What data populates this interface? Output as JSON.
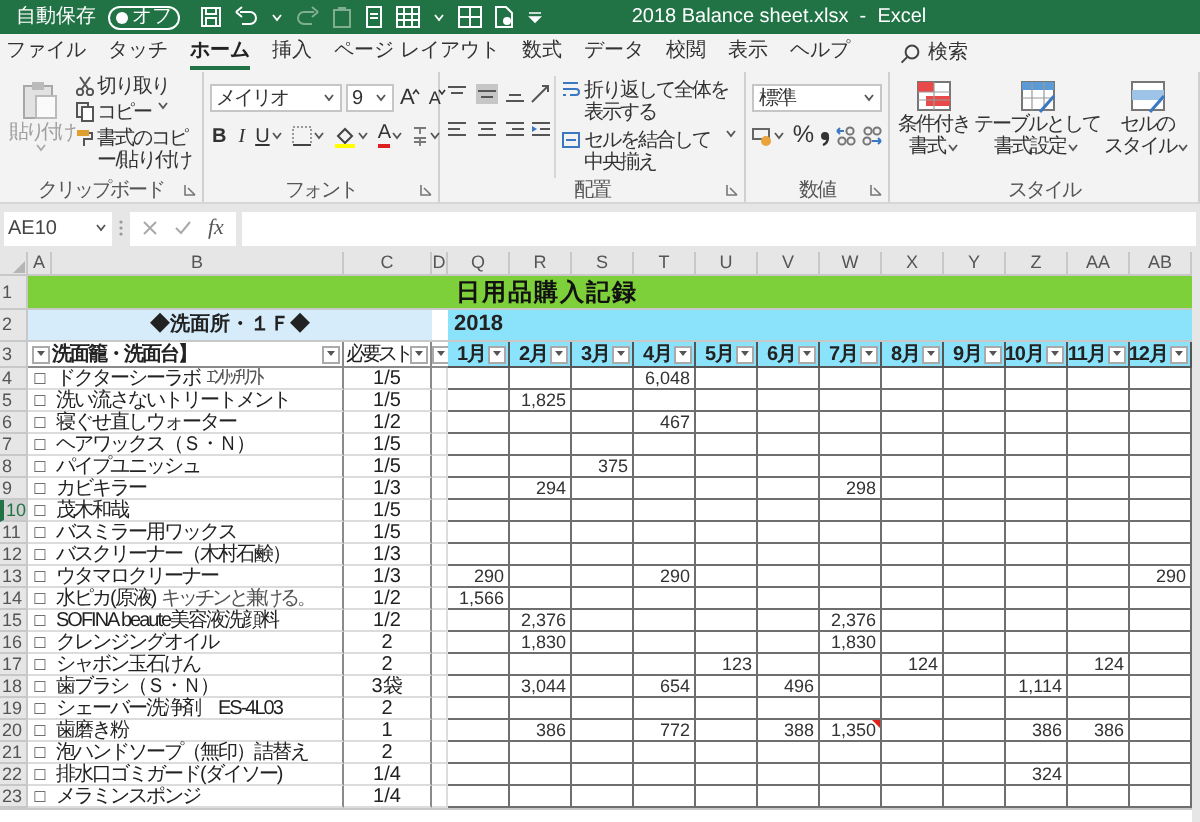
{
  "title_bar": {
    "autosave_label": "自動保存",
    "autosave_state": "オフ",
    "autosave_on": false,
    "title": "2018 Balance sheet.xlsx  -  Excel"
  },
  "menu_tabs": [
    {
      "label": "ファイル",
      "selected": false
    },
    {
      "label": "タッチ",
      "selected": false
    },
    {
      "label": "ホーム",
      "selected": true
    },
    {
      "label": "挿入",
      "selected": false
    },
    {
      "label": "ページ レイアウト",
      "selected": false
    },
    {
      "label": "数式",
      "selected": false
    },
    {
      "label": "データ",
      "selected": false
    },
    {
      "label": "校閲",
      "selected": false
    },
    {
      "label": "表示",
      "selected": false
    },
    {
      "label": "ヘルプ",
      "selected": false
    }
  ],
  "search": {
    "label": "検索"
  },
  "ribbon": {
    "clipboard": {
      "paste": "貼り付け",
      "paste_disabled": true,
      "cut": "切り取り",
      "copy": "コピー",
      "format_painter": "書式のコピー/貼り付け",
      "label": "クリップボード"
    },
    "font": {
      "font_name": "メイリオ",
      "font_size": "9",
      "grow": "A",
      "shrink": "A",
      "bold": "B",
      "italic": "I",
      "underline": "U",
      "font_color": "A",
      "label": "フォント"
    },
    "alignment": {
      "wrap_text": "折り返して全体を表示する",
      "merge_center": "セルを結合して中央揃え",
      "label": "配置"
    },
    "number": {
      "format": "標準",
      "percent": "%",
      "label": "数値"
    },
    "styles": {
      "buttons": [
        {
          "lines": [
            "条件付き",
            "書式"
          ]
        },
        {
          "lines": [
            "テーブルとして",
            "書式設定"
          ]
        },
        {
          "lines": [
            "セルの",
            "スタイル"
          ]
        }
      ],
      "label": "スタイル"
    }
  },
  "formula_bar": {
    "name_box": "AE10",
    "function_label": "fx"
  },
  "sheet": {
    "column_headers": [
      "A",
      "B",
      "C",
      "D",
      "Q",
      "R",
      "S",
      "T",
      "U",
      "V",
      "W",
      "X",
      "Y",
      "Z",
      "AA",
      "AB"
    ],
    "title_row": {
      "number": "1",
      "title": "日用品購入記録"
    },
    "section_row": {
      "number": "2",
      "section": "◆洗面所・１Ｆ◆",
      "year": "2018"
    },
    "header_row": {
      "number": "3",
      "item_header": "洗面籠・洗面台】",
      "quota_header": "必要スト",
      "months": [
        "1月",
        "2月",
        "3月",
        "4月",
        "5月",
        "6月",
        "7月",
        "8月",
        "9月",
        "10月",
        "11月",
        "12月"
      ]
    },
    "rows": [
      {
        "number": "4",
        "selected": false,
        "mark": "□",
        "name": "ドクターシーラボ",
        "note": "ｴﾝﾘｯﾁﾘﾌﾄ",
        "quota": "1/5",
        "months": [
          {
            "comment": false
          },
          {
            "comment": false
          },
          {
            "comment": false
          },
          {
            "value": "6,048",
            "comment": false
          },
          {
            "comment": false
          },
          {
            "comment": false
          },
          {
            "comment": false
          },
          {
            "comment": false
          },
          {
            "comment": false
          },
          {
            "comment": false
          },
          {
            "comment": false
          },
          {
            "comment": false
          }
        ]
      },
      {
        "number": "5",
        "selected": false,
        "mark": "□",
        "name": "洗い流さないトリートメント",
        "quota": "1/5",
        "months": [
          {
            "comment": false
          },
          {
            "value": "1,825",
            "comment": false
          },
          {
            "comment": false
          },
          {
            "comment": false
          },
          {
            "comment": false
          },
          {
            "comment": false
          },
          {
            "comment": false
          },
          {
            "comment": false
          },
          {
            "comment": false
          },
          {
            "comment": false
          },
          {
            "comment": false
          },
          {
            "comment": false
          }
        ]
      },
      {
        "number": "6",
        "selected": false,
        "mark": "□",
        "name": "寝ぐせ直しウォーター",
        "quota": "1/2",
        "months": [
          {
            "comment": false
          },
          {
            "comment": false
          },
          {
            "comment": false
          },
          {
            "value": "467",
            "comment": false
          },
          {
            "comment": false
          },
          {
            "comment": false
          },
          {
            "comment": false
          },
          {
            "comment": false
          },
          {
            "comment": false
          },
          {
            "comment": false
          },
          {
            "comment": false
          },
          {
            "comment": false
          }
        ]
      },
      {
        "number": "7",
        "selected": false,
        "mark": "□",
        "name": "ヘアワックス（Ｓ・Ｎ）",
        "quota": "1/5",
        "months": [
          {
            "comment": false
          },
          {
            "comment": false
          },
          {
            "comment": false
          },
          {
            "comment": false
          },
          {
            "comment": false
          },
          {
            "comment": false
          },
          {
            "comment": false
          },
          {
            "comment": false
          },
          {
            "comment": false
          },
          {
            "comment": false
          },
          {
            "comment": false
          },
          {
            "comment": false
          }
        ]
      },
      {
        "number": "8",
        "selected": false,
        "mark": "□",
        "name": "パイプユニッシュ",
        "quota": "1/5",
        "months": [
          {
            "comment": false
          },
          {
            "comment": false
          },
          {
            "value": "375",
            "comment": false
          },
          {
            "comment": false
          },
          {
            "comment": false
          },
          {
            "comment": false
          },
          {
            "comment": false
          },
          {
            "comment": false
          },
          {
            "comment": false
          },
          {
            "comment": false
          },
          {
            "comment": false
          },
          {
            "comment": false
          }
        ]
      },
      {
        "number": "9",
        "selected": false,
        "mark": "□",
        "name": "カビキラー",
        "quota": "1/3",
        "months": [
          {
            "comment": false
          },
          {
            "value": "294",
            "comment": false
          },
          {
            "comment": false
          },
          {
            "comment": false
          },
          {
            "comment": false
          },
          {
            "comment": false
          },
          {
            "value": "298",
            "comment": false
          },
          {
            "comment": false
          },
          {
            "comment": false
          },
          {
            "comment": false
          },
          {
            "comment": false
          },
          {
            "comment": false
          }
        ]
      },
      {
        "number": "10",
        "selected": true,
        "mark": "□",
        "name": "茂木和哉",
        "quota": "1/5",
        "months": [
          {
            "comment": false
          },
          {
            "comment": false
          },
          {
            "comment": false
          },
          {
            "comment": false
          },
          {
            "comment": false
          },
          {
            "comment": false
          },
          {
            "comment": false
          },
          {
            "comment": false
          },
          {
            "comment": false
          },
          {
            "comment": false
          },
          {
            "comment": false
          },
          {
            "comment": false
          }
        ]
      },
      {
        "number": "11",
        "selected": false,
        "mark": "□",
        "name": "バスミラー用ワックス",
        "quota": "1/5",
        "months": [
          {
            "comment": false
          },
          {
            "comment": false
          },
          {
            "comment": false
          },
          {
            "comment": false
          },
          {
            "comment": false
          },
          {
            "comment": false
          },
          {
            "comment": false
          },
          {
            "comment": false
          },
          {
            "comment": false
          },
          {
            "comment": false
          },
          {
            "comment": false
          },
          {
            "comment": false
          }
        ]
      },
      {
        "number": "12",
        "selected": false,
        "mark": "□",
        "name": "バスクリーナー（木村石鹸）",
        "quota": "1/3",
        "months": [
          {
            "comment": false
          },
          {
            "comment": false
          },
          {
            "comment": false
          },
          {
            "comment": false
          },
          {
            "comment": false
          },
          {
            "comment": false
          },
          {
            "comment": false
          },
          {
            "comment": false
          },
          {
            "comment": false
          },
          {
            "comment": false
          },
          {
            "comment": false
          },
          {
            "comment": false
          }
        ]
      },
      {
        "number": "13",
        "selected": false,
        "mark": "□",
        "name": "ウタマロクリーナー",
        "quota": "1/3",
        "months": [
          {
            "value": "290",
            "comment": false
          },
          {
            "comment": false
          },
          {
            "comment": false
          },
          {
            "value": "290",
            "comment": false
          },
          {
            "comment": false
          },
          {
            "comment": false
          },
          {
            "comment": false
          },
          {
            "comment": false
          },
          {
            "comment": false
          },
          {
            "comment": false
          },
          {
            "comment": false
          },
          {
            "value": "290",
            "comment": false
          }
        ]
      },
      {
        "number": "14",
        "selected": false,
        "mark": "□",
        "name": "水ピカ(原液)",
        "note": "キッチンと兼ける。",
        "quota": "1/2",
        "months": [
          {
            "value": "1,566",
            "comment": false
          },
          {
            "comment": false
          },
          {
            "comment": false
          },
          {
            "comment": false
          },
          {
            "comment": false
          },
          {
            "comment": false
          },
          {
            "comment": false
          },
          {
            "comment": false
          },
          {
            "comment": false
          },
          {
            "comment": false
          },
          {
            "comment": false
          },
          {
            "comment": false
          }
        ]
      },
      {
        "number": "15",
        "selected": false,
        "mark": "□",
        "name": "SOFINA beaute美容液洗顔料",
        "quota": "1/2",
        "months": [
          {
            "comment": false
          },
          {
            "value": "2,376",
            "comment": false
          },
          {
            "comment": false
          },
          {
            "comment": false
          },
          {
            "comment": false
          },
          {
            "comment": false
          },
          {
            "value": "2,376",
            "comment": false
          },
          {
            "comment": false
          },
          {
            "comment": false
          },
          {
            "comment": false
          },
          {
            "comment": false
          },
          {
            "comment": false
          }
        ]
      },
      {
        "number": "16",
        "selected": false,
        "mark": "□",
        "name": "クレンジングオイル",
        "quota": "2",
        "months": [
          {
            "comment": false
          },
          {
            "value": "1,830",
            "comment": false
          },
          {
            "comment": false
          },
          {
            "comment": false
          },
          {
            "comment": false
          },
          {
            "comment": false
          },
          {
            "value": "1,830",
            "comment": false
          },
          {
            "comment": false
          },
          {
            "comment": false
          },
          {
            "comment": false
          },
          {
            "comment": false
          },
          {
            "comment": false
          }
        ]
      },
      {
        "number": "17",
        "selected": false,
        "mark": "□",
        "name": "シャボン玉石けん",
        "quota": "2",
        "months": [
          {
            "comment": false
          },
          {
            "comment": false
          },
          {
            "comment": false
          },
          {
            "comment": false
          },
          {
            "value": "123",
            "comment": false
          },
          {
            "comment": false
          },
          {
            "comment": false
          },
          {
            "value": "124",
            "comment": false
          },
          {
            "comment": false
          },
          {
            "comment": false
          },
          {
            "value": "124",
            "comment": false
          },
          {
            "comment": false
          }
        ]
      },
      {
        "number": "18",
        "selected": false,
        "mark": "□",
        "name": "歯ブラシ（Ｓ・Ｎ）",
        "quota": "3袋",
        "months": [
          {
            "comment": false
          },
          {
            "value": "3,044",
            "comment": false
          },
          {
            "comment": false
          },
          {
            "value": "654",
            "comment": false
          },
          {
            "comment": false
          },
          {
            "value": "496",
            "comment": false
          },
          {
            "comment": false
          },
          {
            "comment": false
          },
          {
            "comment": false
          },
          {
            "value": "1,114",
            "comment": false
          },
          {
            "comment": false
          },
          {
            "comment": false
          }
        ]
      },
      {
        "number": "19",
        "selected": false,
        "mark": "□",
        "name": "シェーバー洗浄剤　ES-4L03",
        "quota": "2",
        "months": [
          {
            "comment": false
          },
          {
            "comment": false
          },
          {
            "comment": false
          },
          {
            "comment": false
          },
          {
            "comment": false
          },
          {
            "comment": false
          },
          {
            "comment": false
          },
          {
            "comment": false
          },
          {
            "comment": false
          },
          {
            "comment": false
          },
          {
            "comment": false
          },
          {
            "comment": false
          }
        ]
      },
      {
        "number": "20",
        "selected": false,
        "mark": "□",
        "name": "歯磨き粉",
        "quota": "1",
        "months": [
          {
            "comment": false
          },
          {
            "value": "386",
            "comment": false
          },
          {
            "comment": false
          },
          {
            "value": "772",
            "comment": false
          },
          {
            "comment": false
          },
          {
            "value": "388",
            "comment": false
          },
          {
            "value": "1,350",
            "comment": true
          },
          {
            "comment": false
          },
          {
            "comment": false
          },
          {
            "value": "386",
            "comment": false
          },
          {
            "value": "386",
            "comment": false
          },
          {
            "comment": false
          }
        ]
      },
      {
        "number": "21",
        "selected": false,
        "mark": "□",
        "name": "泡ハンドソープ（無印）詰替え",
        "quota": "2",
        "months": [
          {
            "comment": false
          },
          {
            "comment": false
          },
          {
            "comment": false
          },
          {
            "comment": false
          },
          {
            "comment": false
          },
          {
            "comment": false
          },
          {
            "comment": false
          },
          {
            "comment": false
          },
          {
            "comment": false
          },
          {
            "comment": false
          },
          {
            "comment": false
          },
          {
            "comment": false
          }
        ]
      },
      {
        "number": "22",
        "selected": false,
        "mark": "□",
        "name": "排水口ゴミガード(ダイソー)",
        "quota": "1/4",
        "months": [
          {
            "comment": false
          },
          {
            "comment": false
          },
          {
            "comment": false
          },
          {
            "comment": false
          },
          {
            "comment": false
          },
          {
            "comment": false
          },
          {
            "comment": false
          },
          {
            "comment": false
          },
          {
            "comment": false
          },
          {
            "value": "324",
            "comment": false
          },
          {
            "comment": false
          },
          {
            "comment": false
          }
        ]
      },
      {
        "number": "23",
        "selected": false,
        "mark": "□",
        "name": "メラミンスポンジ",
        "quota": "1/4",
        "months": [
          {
            "comment": false
          },
          {
            "comment": false
          },
          {
            "comment": false
          },
          {
            "comment": false
          },
          {
            "comment": false
          },
          {
            "comment": false
          },
          {
            "comment": false
          },
          {
            "comment": false
          },
          {
            "comment": false
          },
          {
            "comment": false
          },
          {
            "comment": false
          },
          {
            "comment": false
          }
        ]
      }
    ]
  }
}
